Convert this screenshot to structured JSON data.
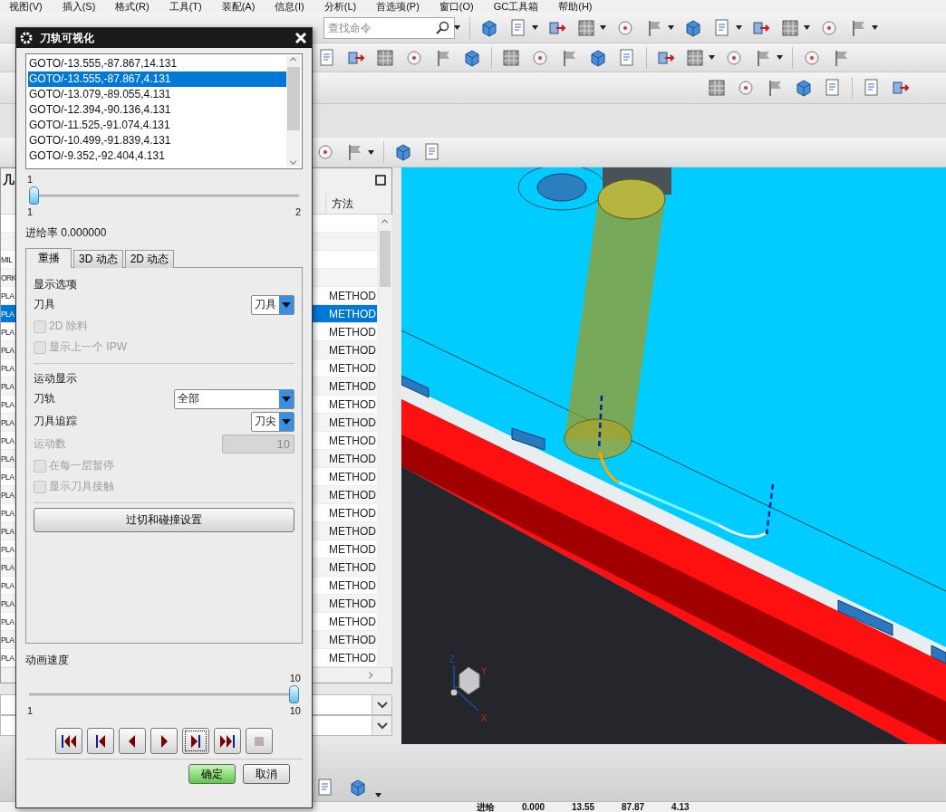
{
  "menu": [
    "视图(V)",
    "插入(S)",
    "格式(R)",
    "工具(T)",
    "装配(A)",
    "信息(I)",
    "分析(L)",
    "首选项(P)",
    "窗口(O)",
    "GC工具箱",
    "帮助(H)"
  ],
  "search": {
    "placeholder": "查找命令"
  },
  "navigator": {
    "title": "几",
    "columns": [
      "方法"
    ],
    "rows": [
      {
        "name": "",
        "method": "",
        "selected": false
      },
      {
        "name": "",
        "method": "",
        "selected": false
      },
      {
        "name": "MIL",
        "method": "",
        "selected": false
      },
      {
        "name": "ORK",
        "method": "",
        "selected": false
      },
      {
        "name": "PLA",
        "method": "METHOD",
        "selected": false
      },
      {
        "name": "PLA",
        "method": "METHOD",
        "selected": true
      },
      {
        "name": "PLA",
        "method": "METHOD",
        "selected": false
      },
      {
        "name": "PLA",
        "method": "METHOD",
        "selected": false
      },
      {
        "name": "PLA",
        "method": "METHOD",
        "selected": false
      },
      {
        "name": "PLA",
        "method": "METHOD",
        "selected": false
      },
      {
        "name": "PLA",
        "method": "METHOD",
        "selected": false
      },
      {
        "name": "PLA",
        "method": "METHOD",
        "selected": false
      },
      {
        "name": "PLA",
        "method": "METHOD",
        "selected": false
      },
      {
        "name": "PLA",
        "method": "METHOD",
        "selected": false
      },
      {
        "name": "PLA",
        "method": "METHOD",
        "selected": false
      },
      {
        "name": "PLA",
        "method": "METHOD",
        "selected": false
      },
      {
        "name": "PLA",
        "method": "METHOD",
        "selected": false
      },
      {
        "name": "PLA",
        "method": "METHOD",
        "selected": false
      },
      {
        "name": "PLA",
        "method": "METHOD",
        "selected": false
      },
      {
        "name": "PLA",
        "method": "METHOD",
        "selected": false
      },
      {
        "name": "PLA",
        "method": "METHOD",
        "selected": false
      },
      {
        "name": "PLA",
        "method": "METHOD",
        "selected": false
      },
      {
        "name": "PLA",
        "method": "METHOD",
        "selected": false
      },
      {
        "name": "PLA",
        "method": "METHOD",
        "selected": false
      },
      {
        "name": "PLA",
        "method": "METHOD",
        "selected": false
      }
    ]
  },
  "viewport": {
    "axes": [
      "Z",
      "Y",
      "X"
    ]
  },
  "status_bar": [
    "进给",
    "0.000",
    "13.55",
    "87.87",
    "4.13"
  ],
  "dialog": {
    "title": "刀轨可视化",
    "list": [
      {
        "text": "GOTO/-13.555,-87.867,14.131",
        "selected": false
      },
      {
        "text": "GOTO/-13.555,-87.867,4.131",
        "selected": true
      },
      {
        "text": "GOTO/-13.079,-89.055,4.131",
        "selected": false
      },
      {
        "text": "GOTO/-12.394,-90.136,4.131",
        "selected": false
      },
      {
        "text": "GOTO/-11.525,-91.074,4.131",
        "selected": false
      },
      {
        "text": "GOTO/-10.499,-91.839,4.131",
        "selected": false
      },
      {
        "text": "GOTO/-9.352,-92.404,4.131",
        "selected": false
      }
    ],
    "step_slider": {
      "value": "1",
      "min": "1",
      "max": "2",
      "level": 0
    },
    "feed_rate": "进给率 0.000000",
    "tabs": [
      {
        "label": "重播",
        "selected": true
      },
      {
        "label": "3D 动态",
        "selected": false
      },
      {
        "label": "2D 动态",
        "selected": false
      }
    ],
    "display_options": {
      "heading": "显示选项",
      "tool_label": "刀具",
      "tool_value": "刀具",
      "checkboxes": [
        {
          "label": "2D 除料",
          "checked": false,
          "disabled": true
        },
        {
          "label": "显示上一个 IPW",
          "checked": false,
          "disabled": true
        }
      ]
    },
    "motion_display": {
      "heading": "运动显示",
      "path_label": "刀轨",
      "path_value": "全部",
      "trace_label": "刀具追踪",
      "trace_value": "刀尖",
      "count_label": "运动数",
      "count_value": "10",
      "count_disabled": true,
      "checkboxes": [
        {
          "label": "在每一层暂停",
          "checked": false,
          "disabled": true
        },
        {
          "label": "显示刀具接触",
          "checked": false,
          "disabled": true
        }
      ]
    },
    "settings_button": "过切和碰撞设置",
    "speed": {
      "label": "动画速度",
      "value": "10",
      "min": "1",
      "max": "10",
      "level": 1
    },
    "playback": [
      {
        "kind": "rewind",
        "focused": false,
        "disabled": false
      },
      {
        "kind": "step_back",
        "focused": false,
        "disabled": false
      },
      {
        "kind": "reverse",
        "focused": false,
        "disabled": false
      },
      {
        "kind": "play",
        "focused": false,
        "disabled": false
      },
      {
        "kind": "step_forward",
        "focused": true,
        "disabled": false
      },
      {
        "kind": "fast_forward",
        "focused": false,
        "disabled": false
      },
      {
        "kind": "stop",
        "focused": false,
        "disabled": true
      }
    ],
    "buttons": [
      {
        "label": "确定",
        "primary": true
      },
      {
        "label": "取消",
        "primary": false
      }
    ]
  }
}
